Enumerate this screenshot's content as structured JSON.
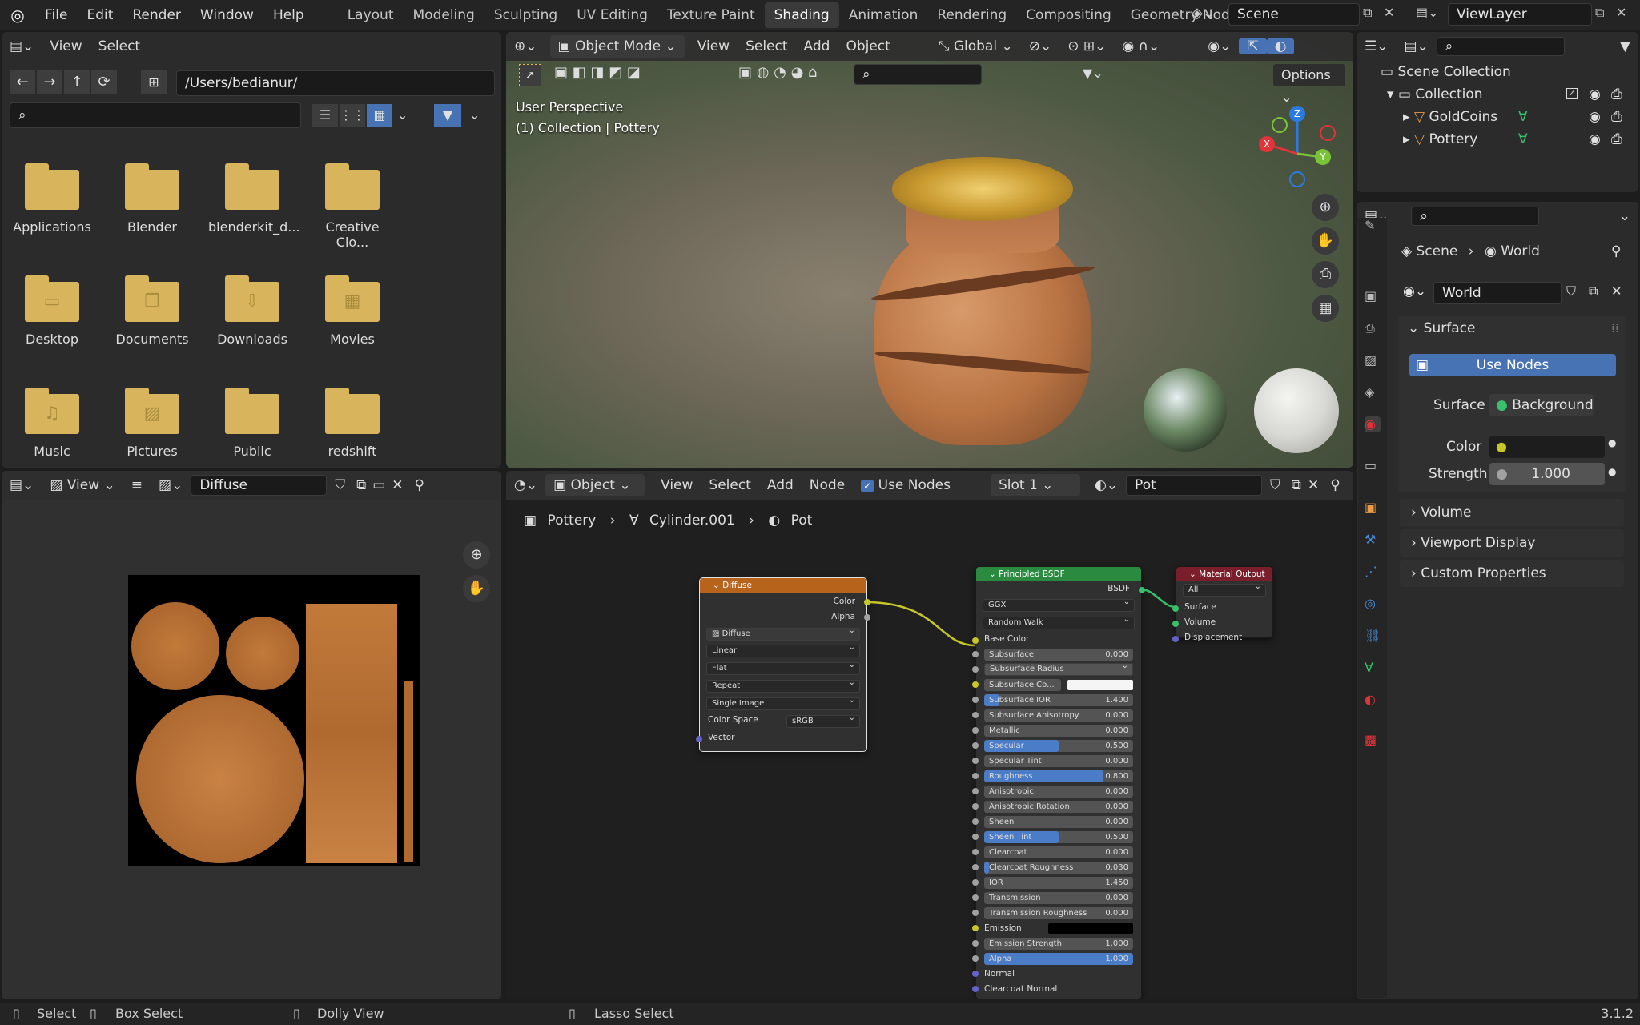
{
  "menu": {
    "items": [
      "File",
      "Edit",
      "Render",
      "Window",
      "Help"
    ]
  },
  "workspaces": [
    "Layout",
    "Modeling",
    "Sculpting",
    "UV Editing",
    "Texture Paint",
    "Shading",
    "Animation",
    "Rendering",
    "Compositing",
    "Geometry Nodes"
  ],
  "scene": "Scene",
  "viewlayer": "ViewLayer",
  "file_browser": {
    "view": "View",
    "select": "Select",
    "path": "/Users/bedianur/",
    "folders": [
      "Applications",
      "Blender",
      "blenderkit_d...",
      "Creative Clo...",
      "Desktop",
      "Documents",
      "Downloads",
      "Movies",
      "Music",
      "Pictures",
      "Public",
      "redshift"
    ]
  },
  "viewport": {
    "mode": "Object Mode",
    "menus": [
      "View",
      "Select",
      "Add",
      "Object"
    ],
    "orientation": "Global",
    "options": "Options",
    "title": "User Perspective",
    "subtitle": "(1) Collection | Pottery",
    "axes": {
      "x": "X",
      "y": "Y",
      "z": "Z"
    }
  },
  "image_editor": {
    "view": "View",
    "image": "Diffuse"
  },
  "node_editor": {
    "type": "Object",
    "menus": [
      "View",
      "Select",
      "Add",
      "Node"
    ],
    "use_nodes": "Use Nodes",
    "slot": "Slot 1",
    "material": "Pot",
    "breadcrumb": [
      "Pottery",
      "Cylinder.001",
      "Pot"
    ]
  },
  "image_node": {
    "title": "Diffuse",
    "out_color": "Color",
    "out_alpha": "Alpha",
    "image": "Diffuse",
    "interp": "Linear",
    "proj": "Flat",
    "ext": "Repeat",
    "source": "Single Image",
    "cs_label": "Color Space",
    "cs": "sRGB",
    "vector": "Vector"
  },
  "bsdf": {
    "title": "Principled BSDF",
    "out": "BSDF",
    "dist": "GGX",
    "sss": "Random Walk",
    "base_color": "Base Color",
    "rows": [
      {
        "l": "Subsurface",
        "v": "0.000",
        "f": 0
      },
      {
        "l": "Subsurface Radius",
        "v": "",
        "f": 0,
        "dd": true
      },
      {
        "l": "Subsurface Co...",
        "v": "",
        "f": 0,
        "white": true
      },
      {
        "l": "Subsurface IOR",
        "v": "1.400",
        "f": 0.1
      },
      {
        "l": "Subsurface Anisotropy",
        "v": "0.000",
        "f": 0
      },
      {
        "l": "Metallic",
        "v": "0.000",
        "f": 0
      },
      {
        "l": "Specular",
        "v": "0.500",
        "f": 0.5
      },
      {
        "l": "Specular Tint",
        "v": "0.000",
        "f": 0
      },
      {
        "l": "Roughness",
        "v": "0.800",
        "f": 0.8
      },
      {
        "l": "Anisotropic",
        "v": "0.000",
        "f": 0
      },
      {
        "l": "Anisotropic Rotation",
        "v": "0.000",
        "f": 0
      },
      {
        "l": "Sheen",
        "v": "0.000",
        "f": 0
      },
      {
        "l": "Sheen Tint",
        "v": "0.500",
        "f": 0.5
      },
      {
        "l": "Clearcoat",
        "v": "0.000",
        "f": 0
      },
      {
        "l": "Clearcoat Roughness",
        "v": "0.030",
        "f": 0.03
      },
      {
        "l": "IOR",
        "v": "1.450",
        "f": 0
      },
      {
        "l": "Transmission",
        "v": "0.000",
        "f": 0
      },
      {
        "l": "Transmission Roughness",
        "v": "0.000",
        "f": 0
      },
      {
        "l": "Emission",
        "v": "",
        "f": 0,
        "black": true
      },
      {
        "l": "Emission Strength",
        "v": "1.000",
        "f": 0
      },
      {
        "l": "Alpha",
        "v": "1.000",
        "f": 1
      },
      {
        "l": "Normal",
        "v": "",
        "f": 0,
        "plain": true
      },
      {
        "l": "Clearcoat Normal",
        "v": "",
        "f": 0,
        "plain": true
      }
    ]
  },
  "matout": {
    "title": "Material Output",
    "target": "All",
    "surface": "Surface",
    "volume": "Volume",
    "disp": "Displacement"
  },
  "outliner": {
    "root": "Scene Collection",
    "collection": "Collection",
    "items": [
      "GoldCoins",
      "Pottery"
    ]
  },
  "properties": {
    "crumb1": "Scene",
    "crumb2": "World",
    "world": "World",
    "surface_header": "Surface",
    "use_nodes": "Use Nodes",
    "surface_label": "Surface",
    "surface_value": "Background",
    "color_label": "Color",
    "strength_label": "Strength",
    "strength_value": "1.000",
    "panels": [
      "Volume",
      "Viewport Display",
      "Custom Properties"
    ]
  },
  "status": {
    "select": "Select",
    "box": "Box Select",
    "dolly": "Dolly View",
    "lasso": "Lasso Select",
    "version": "3.1.2"
  },
  "colors": {
    "accent": "#4772b3",
    "image_node": "#b8631b",
    "bsdf_node": "#2a8a3f",
    "output_node": "#7a1e2b",
    "socket_yellow": "#c7c729",
    "socket_green": "#38c06a",
    "socket_grey": "#a1a1a1",
    "socket_purple": "#6363c7"
  }
}
